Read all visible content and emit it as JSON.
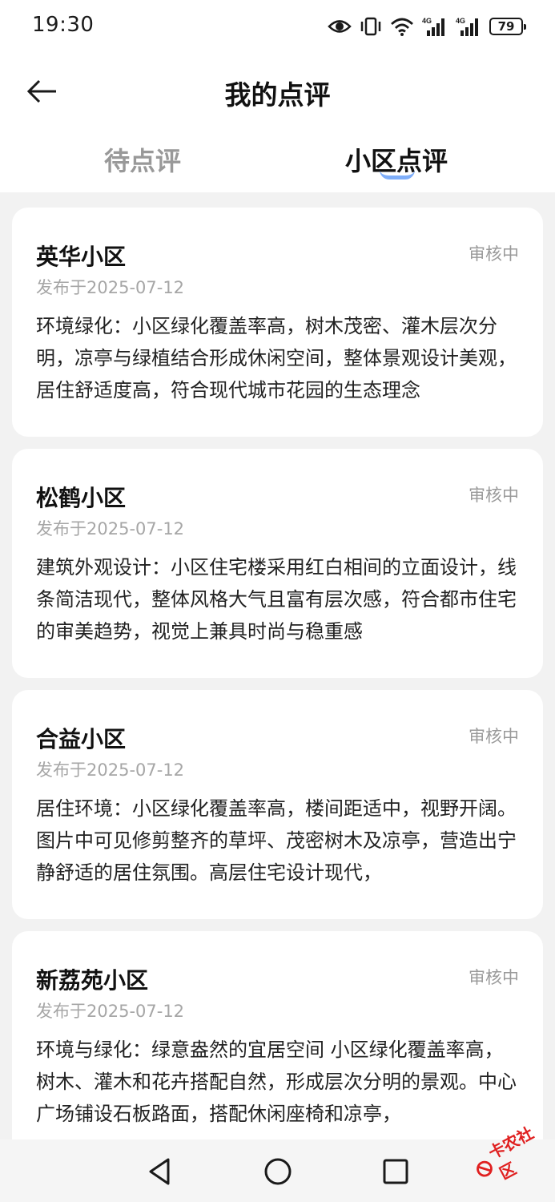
{
  "status_bar": {
    "time": "19:30",
    "battery": "79",
    "icons": [
      "eye-icon",
      "vibrate-icon",
      "wifi-icon",
      "signal-4g-icon",
      "signal-4g-icon",
      "battery-icon"
    ]
  },
  "header": {
    "title": "我的点评",
    "back_icon": "arrow-left-icon"
  },
  "tabs": [
    {
      "label": "待点评",
      "active": false
    },
    {
      "label": "小区点评",
      "active": true
    }
  ],
  "colors": {
    "accent": "#4a8cf7",
    "inactive_tab": "#999999",
    "status_text": "#9a9a9a",
    "background": "#f2f2f2",
    "watermark": "#e02020"
  },
  "reviews": [
    {
      "name": "英华小区",
      "status": "审核中",
      "date": "发布于2025-07-12",
      "text": "环境绿化：小区绿化覆盖率高，树木茂密、灌木层次分明，凉亭与绿植结合形成休闲空间，整体景观设计美观，居住舒适度高，符合现代城市花园的生态理念"
    },
    {
      "name": "松鹤小区",
      "status": "审核中",
      "date": "发布于2025-07-12",
      "text": "建筑外观设计：小区住宅楼采用红白相间的立面设计，线条简洁现代，整体风格大气且富有层次感，符合都市住宅的审美趋势，视觉上兼具时尚与稳重感"
    },
    {
      "name": "合益小区",
      "status": "审核中",
      "date": "发布于2025-07-12",
      "text": "居住环境：小区绿化覆盖率高，楼间距适中，视野开阔。图片中可见修剪整齐的草坪、茂密树木及凉亭，营造出宁静舒适的居住氛围。高层住宅设计现代，"
    },
    {
      "name": "新荔苑小区",
      "status": "审核中",
      "date": "发布于2025-07-12",
      "text": "环境与绿化：绿意盎然的宜居空间 小区绿化覆盖率高，树木、灌木和花卉搭配自然，形成层次分明的景观。中心广场铺设石板路面，搭配休闲座椅和凉亭，"
    }
  ],
  "watermark": "卡农社区"
}
